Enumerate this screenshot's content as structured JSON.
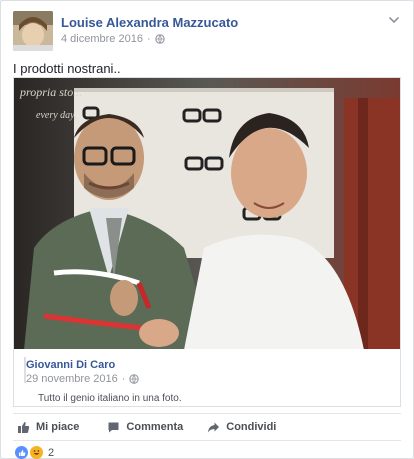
{
  "post": {
    "author": "Louise Alexandra Mazzucato",
    "date": "4 dicembre 2016",
    "privacy_icon": "globe-icon",
    "text": "I prodotti nostrani..",
    "photo_overlay_text_1": "propria sto...",
    "photo_overlay_text_2": "every day,"
  },
  "shared": {
    "author": "Giovanni Di Caro",
    "date": "29 novembre 2016",
    "privacy_icon": "globe-icon",
    "text": "Tutto il genio italiano in una foto."
  },
  "actions": {
    "like": "Mi piace",
    "comment": "Commenta",
    "share": "Condividi"
  },
  "reactions": {
    "count": "2",
    "types": [
      "like-icon",
      "haha-icon"
    ]
  },
  "colors": {
    "link": "#365899",
    "meta": "#90949c",
    "like_blue": "#5890ff",
    "haha_yellow": "#f7b125"
  }
}
